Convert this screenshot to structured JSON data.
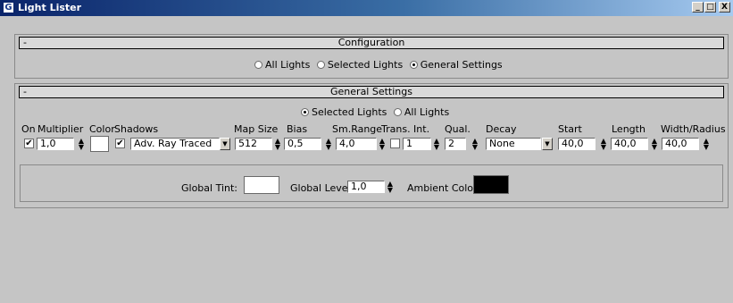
{
  "window": {
    "title": "Light Lister",
    "app_icon_glyph": "G",
    "controls": {
      "minimize": "_",
      "maximize": "□",
      "close": "X"
    }
  },
  "configuration": {
    "collapse_glyph": "-",
    "title": "Configuration",
    "options": [
      "All Lights",
      "Selected Lights",
      "General Settings"
    ],
    "selected": "General Settings"
  },
  "general_settings": {
    "collapse_glyph": "-",
    "title": "General Settings",
    "scope_options": [
      "Selected Lights",
      "All Lights"
    ],
    "scope_selected": "Selected Lights",
    "columns": {
      "on": "On",
      "multiplier": "Multiplier",
      "color": "Color",
      "shadows": "Shadows",
      "map_size": "Map Size",
      "bias": "Bias",
      "sm_range": "Sm.Range",
      "trans_int": "Trans. Int.",
      "qual": "Qual.",
      "decay": "Decay",
      "start": "Start",
      "length": "Length",
      "width_radius": "Width/Radius"
    },
    "values": {
      "on_checked": true,
      "multiplier": "1,0",
      "color": "#ffffff",
      "shadows_checked": true,
      "shadow_type": "Adv. Ray Traced",
      "map_size": "512",
      "bias": "0,5",
      "sm_range": "4,0",
      "trans_checked": false,
      "trans_int": "1",
      "qual": "2",
      "decay": "None",
      "start": "40,0",
      "length": "40,0",
      "width_radius": "40,0"
    }
  },
  "global": {
    "tint_label": "Global Tint:",
    "tint_color": "#ffffff",
    "level_label": "Global Level:",
    "level_value": "1,0",
    "ambient_label": "Ambient Color",
    "ambient_color": "#000000"
  },
  "icons": {
    "spinner": "spinner-icon",
    "dropdown": "dropdown-arrow-icon",
    "check": "checkmark-icon",
    "spin_up_glyph": "▲",
    "spin_down_glyph": "▼",
    "dropdown_glyph": "▼",
    "check_glyph": "✔"
  }
}
